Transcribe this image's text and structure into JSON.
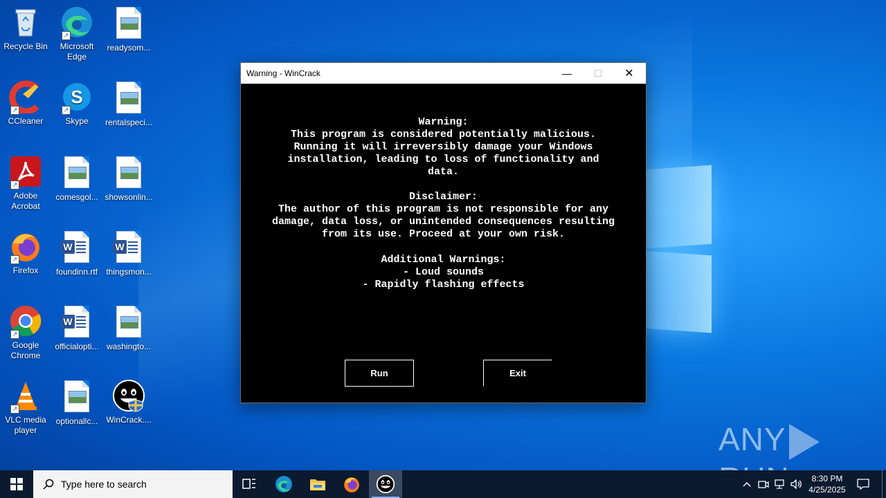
{
  "desktop": {
    "icons": [
      {
        "label": "Recycle Bin"
      },
      {
        "label": "Microsoft Edge"
      },
      {
        "label": "readysom..."
      },
      {
        "label": "CCleaner"
      },
      {
        "label": "Skype"
      },
      {
        "label": "rentalspeci..."
      },
      {
        "label": "Adobe Acrobat"
      },
      {
        "label": "comesgol..."
      },
      {
        "label": "showsonlin..."
      },
      {
        "label": "Firefox"
      },
      {
        "label": "foundinn.rtf"
      },
      {
        "label": "thingsmon..."
      },
      {
        "label": "Google Chrome"
      },
      {
        "label": "officialopti..."
      },
      {
        "label": "washingto..."
      },
      {
        "label": "VLC media player"
      },
      {
        "label": "optionallc..."
      },
      {
        "label": "WinCrack...."
      }
    ]
  },
  "dialog": {
    "title": "Warning - WinCrack",
    "minimize_glyph": "—",
    "maximize_glyph": "☐",
    "close_glyph": "✕",
    "warning_heading": "Warning:",
    "warning_lines": "This program is considered potentially malicious.\nRunning it will irreversibly damage your Windows\ninstallation, leading to loss of functionality and\ndata.",
    "disclaimer_heading": "Disclaimer:",
    "disclaimer_lines": "The author of this program is not responsible for any\ndamage, data loss, or unintended consequences resulting\nfrom its use. Proceed at your own risk.",
    "additional_heading": "Additional Warnings:",
    "additional_lines": "- Loud sounds\n- Rapidly flashing effects",
    "run_label": "Run",
    "exit_label": "Exit"
  },
  "watermark": {
    "left": "ANY",
    "right": "RUN"
  },
  "taskbar": {
    "search_placeholder": "Type here to search",
    "clock_time": "8:30 PM",
    "clock_date": "4/25/2025"
  },
  "colors": {
    "desktop_blue": "#0a78e0",
    "taskbar": "#0b1a2f",
    "dialog_bg": "#000000"
  }
}
